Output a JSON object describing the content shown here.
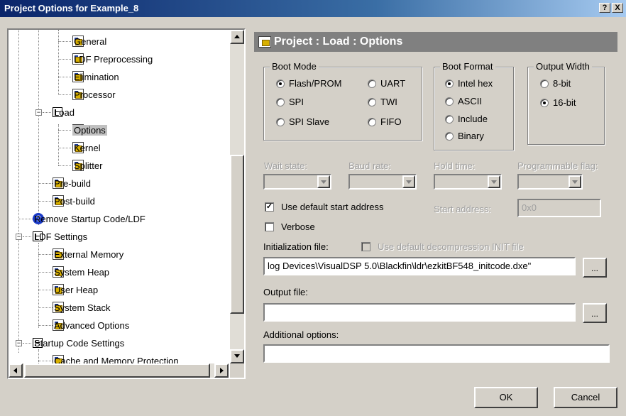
{
  "window": {
    "title": "Project Options for Example_8",
    "help_btn": "?",
    "close_btn": "X"
  },
  "tree": {
    "items": [
      {
        "label": "General",
        "icon": "options-page-icon"
      },
      {
        "label": "LDF Preprocessing",
        "icon": "options-page-icon"
      },
      {
        "label": "Elimination",
        "icon": "options-page-icon"
      },
      {
        "label": "Processor",
        "icon": "options-page-icon"
      },
      {
        "label": "Load",
        "icon": "folder-icon"
      },
      {
        "label": "Options",
        "icon": "options-page-icon",
        "selected": true
      },
      {
        "label": "Kernel",
        "icon": "options-page-icon"
      },
      {
        "label": "Splitter",
        "icon": "options-page-icon"
      },
      {
        "label": "Pre-build",
        "icon": "options-page-icon"
      },
      {
        "label": "Post-build",
        "icon": "options-page-icon"
      },
      {
        "label": "Remove Startup Code/LDF",
        "icon": "help-icon"
      },
      {
        "label": "LDF Settings",
        "icon": "folder-icon"
      },
      {
        "label": "External Memory",
        "icon": "options-page-icon"
      },
      {
        "label": "System Heap",
        "icon": "options-page-icon"
      },
      {
        "label": "User Heap",
        "icon": "options-page-icon"
      },
      {
        "label": "System Stack",
        "icon": "options-page-icon"
      },
      {
        "label": "Advanced Options",
        "icon": "options-page-icon"
      },
      {
        "label": "Startup Code Settings",
        "icon": "folder-icon"
      },
      {
        "label": "Cache and Memory Protection",
        "icon": "options-page-icon"
      }
    ]
  },
  "panel": {
    "title": "Project : Load : Options",
    "boot_mode": {
      "title": "Boot Mode",
      "options": [
        "Flash/PROM",
        "SPI",
        "SPI Slave",
        "UART",
        "TWI",
        "FIFO"
      ],
      "selected": "Flash/PROM"
    },
    "boot_format": {
      "title": "Boot Format",
      "options": [
        "Intel hex",
        "ASCII",
        "Include",
        "Binary"
      ],
      "selected": "Intel hex"
    },
    "output_width": {
      "title": "Output Width",
      "options": [
        "8-bit",
        "16-bit"
      ],
      "selected": "16-bit"
    },
    "wait_state": "Wait state:",
    "baud_rate": "Baud rate:",
    "hold_time": "Hold time:",
    "programmable_flag": "Programmable flag:",
    "use_default_start": "Use default start address",
    "use_default_start_checked": true,
    "start_address_label": "Start address:",
    "start_address_value": "0x0",
    "verbose": "Verbose",
    "verbose_checked": false,
    "init_file_label": "Initialization file:",
    "use_default_decomp": "Use default decompression INIT file",
    "init_file_value": "log Devices\\VisualDSP 5.0\\Blackfin\\ldr\\ezkitBF548_initcode.dxe\"",
    "output_file_label": "Output file:",
    "output_file_value": "",
    "additional_label": "Additional options:",
    "additional_value": "",
    "browse": "...",
    "ok": "OK",
    "cancel": "Cancel"
  },
  "colors": {
    "titlebar_start": "#0a246a",
    "panel_header_bg": "#808080",
    "dialog_bg": "#d4d0c8"
  }
}
